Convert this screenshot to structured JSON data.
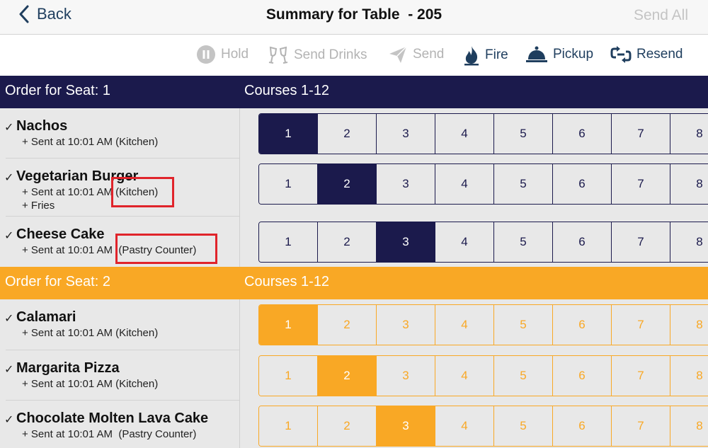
{
  "nav": {
    "back_label": "Back",
    "title": "Summary for Table  - 205",
    "send_all_label": "Send All"
  },
  "toolbar": {
    "hold": {
      "label": "Hold",
      "icon": "pause-icon",
      "enabled": false
    },
    "send_drinks": {
      "label": "Send Drinks",
      "icon": "glasses-icon",
      "enabled": false
    },
    "send": {
      "label": "Send",
      "icon": "paper-plane-icon",
      "enabled": false
    },
    "fire": {
      "label": "Fire",
      "icon": "flame-icon",
      "enabled": true
    },
    "pickup": {
      "label": "Pickup",
      "icon": "service-bell-icon",
      "enabled": true
    },
    "resend": {
      "label": "Resend",
      "icon": "link-arrows-icon",
      "enabled": true
    }
  },
  "colors": {
    "seat1": "#1b1a4c",
    "seat2": "#f9a825",
    "enabled_action": "#1f3e5e",
    "highlight": "#e0242b"
  },
  "seats": [
    {
      "header": "Order for Seat: 1",
      "courses_label": "Courses 1-12",
      "course_buttons": [
        "1",
        "2",
        "3",
        "4",
        "5",
        "6",
        "7",
        "8"
      ],
      "items": [
        {
          "check": "✓",
          "name": "Nachos",
          "sent": "+ Sent at 10:01 AM (Kitchen)",
          "modifier": "",
          "selected_course": "1"
        },
        {
          "check": "✓",
          "name": "Vegetarian Burger",
          "sent": "+ Sent at 10:01 AM (Kitchen)",
          "modifier": "+ Fries",
          "selected_course": "2"
        },
        {
          "check": "✓",
          "name": "Cheese Cake",
          "sent": "+ Sent at 10:01 AM  (Pastry Counter)",
          "modifier": "",
          "selected_course": "3"
        }
      ]
    },
    {
      "header": "Order for Seat: 2",
      "courses_label": "Courses 1-12",
      "course_buttons": [
        "1",
        "2",
        "3",
        "4",
        "5",
        "6",
        "7",
        "8"
      ],
      "items": [
        {
          "check": "✓",
          "name": "Calamari",
          "sent": "+ Sent at 10:01 AM (Kitchen)",
          "modifier": "",
          "selected_course": "1"
        },
        {
          "check": "✓",
          "name": "Margarita Pizza",
          "sent": "+ Sent at 10:01 AM (Kitchen)",
          "modifier": "",
          "selected_course": "2"
        },
        {
          "check": "✓",
          "name": "Chocolate Molten Lava Cake",
          "sent": "+ Sent at 10:01 AM  (Pastry Counter)",
          "modifier": "",
          "selected_course": "3"
        }
      ]
    }
  ]
}
